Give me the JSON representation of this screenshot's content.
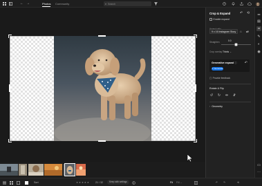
{
  "topbar": {
    "tabs": [
      {
        "label": "Photos",
        "active": true
      },
      {
        "label": "Community",
        "active": false
      }
    ],
    "search": {
      "placeholder": "Search"
    },
    "icons": [
      "grid-icon",
      "back-arrow-icon",
      "forward-arrow-icon",
      "search-icon",
      "filter-icon",
      "help-icon",
      "bell-icon",
      "share-icon",
      "cloud-icon",
      "avatar"
    ]
  },
  "panel": {
    "title": "Crop & Expand",
    "enable_expand_label": "Enable expand",
    "aspect_ratio": {
      "label": "Aspect ratio",
      "value": "9 x 16 Instagram Story"
    },
    "straighten": {
      "label": "Straighten",
      "value": "0.0",
      "position": 0.5
    },
    "crop_overlay": {
      "label": "Crop overlay",
      "value": "Thirds"
    },
    "generative_expand": {
      "title": "Generative expand",
      "button_label": "Generate"
    },
    "provide_feedback_label": "Provide feedback",
    "rotate_flip_label": "Rotate & Flip",
    "geometry_label": "Geometry"
  },
  "bottombar": {
    "fit_label": "Fit",
    "zoom_label": "Fill",
    "rating": 0,
    "counter": "21 / 32",
    "pill_label": "Keep with settings",
    "sort_label": "Sort"
  },
  "accent": "#1473e6",
  "filmstrip": {
    "count": 7,
    "selected_index": 5
  }
}
